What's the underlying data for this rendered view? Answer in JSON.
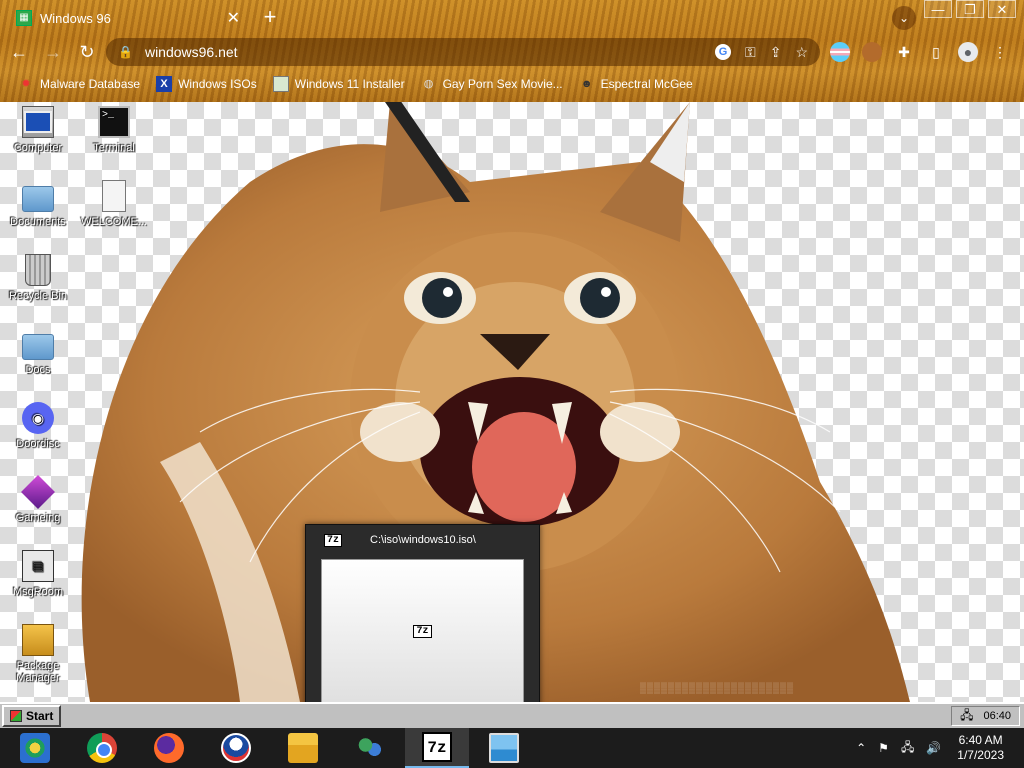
{
  "browser": {
    "tab": {
      "title": "Windows 96",
      "close": "✕"
    },
    "new_tab": "+",
    "window_buttons": [
      "—",
      "❐",
      "✕"
    ],
    "nav": {
      "back": "←",
      "forward": "→",
      "reload": "↻"
    },
    "url": "windows96.net",
    "bookmarks": [
      {
        "label": "Malware Database",
        "icon": "virus-icon"
      },
      {
        "label": "Windows ISOs",
        "icon": "x-icon"
      },
      {
        "label": "Windows 11 Installer",
        "icon": "window-icon"
      },
      {
        "label": "Gay Porn Sex Movie...",
        "icon": "globe-icon"
      },
      {
        "label": "Espectral McGee",
        "icon": "face-icon"
      }
    ]
  },
  "desktop": {
    "icons": [
      {
        "label": "Computer",
        "icon": "computer-icon"
      },
      {
        "label": "Terminal",
        "icon": "terminal-icon"
      },
      {
        "label": "Documents",
        "icon": "folder-icon"
      },
      {
        "label": "WELCOME...",
        "icon": "document-icon"
      },
      {
        "label": "Recycle Bin",
        "icon": "recycle-bin-icon"
      },
      {
        "label": "Docs",
        "icon": "folder-icon"
      },
      {
        "label": "Doordisc",
        "icon": "discord-icon"
      },
      {
        "label": "Gameing",
        "icon": "cube-icon"
      },
      {
        "label": "MsgRoom",
        "icon": "msgroom-icon"
      },
      {
        "label": "Package Manager",
        "icon": "package-icon"
      }
    ],
    "window_7z": {
      "title": "C:\\iso\\windows10.iso\\",
      "icon_text": "7z"
    }
  },
  "taskbar96": {
    "start": "Start",
    "time": "06:40"
  },
  "host_taskbar": {
    "apps": [
      "windows96-icon",
      "chrome-icon",
      "firefox-icon",
      "obama-icon",
      "file-explorer-icon",
      "msn-icon",
      "7zip-icon",
      "photos-icon"
    ],
    "clock_time": "6:40 AM",
    "clock_date": "1/7/2023"
  }
}
